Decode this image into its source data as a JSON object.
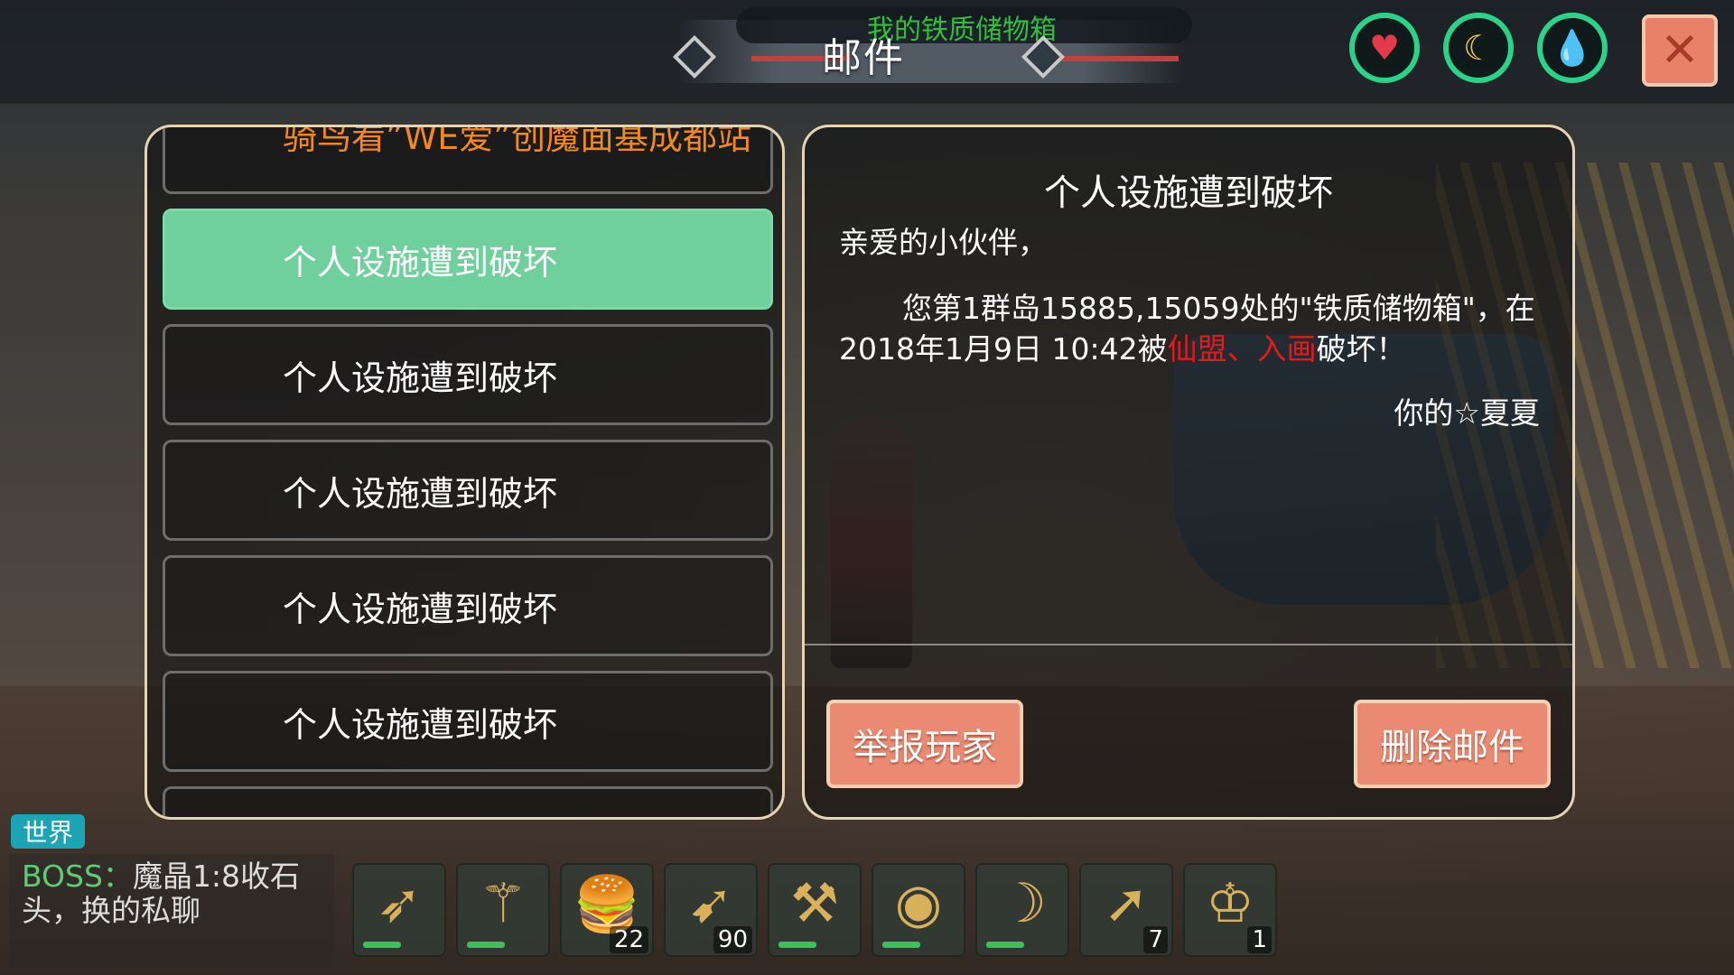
{
  "header": {
    "title": "邮件",
    "subtitle": "我的铁质储物箱"
  },
  "stats": [
    {
      "name": "health",
      "icon": "heart-icon",
      "glyph": "♥",
      "color": "#e23a4a"
    },
    {
      "name": "hunger",
      "icon": "banana-icon",
      "glyph": "☾",
      "color": "#f2d23b"
    },
    {
      "name": "thirst",
      "icon": "water-drop-icon",
      "glyph": "💧",
      "color": "#35c6e6"
    }
  ],
  "close_glyph": "✕",
  "mail_list": {
    "partial_top": "骑鸟看”WE爱”创魔面基成都站",
    "items": [
      {
        "label": "个人设施遭到破坏"
      },
      {
        "label": "个人设施遭到破坏"
      },
      {
        "label": "个人设施遭到破坏"
      },
      {
        "label": "个人设施遭到破坏"
      },
      {
        "label": "个人设施遭到破坏"
      }
    ]
  },
  "mail_detail": {
    "title": "个人设施遭到破坏",
    "greeting": "亲爱的小伙伴，",
    "body_before": "您第1群岛15885,15059处的\"铁质储物箱\"，在2018年1月9日 10:42被",
    "attacker": "仙盟、入画",
    "body_after": "破坏！",
    "signature": "你的☆夏夏",
    "report_button": "举报玩家",
    "delete_button": "删除邮件"
  },
  "chat": {
    "channel": "世界",
    "sender": "BOSS：",
    "message": "魔晶1:8收石头，换的私聊"
  },
  "hotbar": [
    {
      "icon": "bow-icon",
      "glyph": "➶",
      "count": "",
      "durability": true
    },
    {
      "icon": "staff-icon",
      "glyph": "⚚",
      "count": "",
      "durability": true
    },
    {
      "icon": "burger-icon",
      "glyph": "🍔",
      "count": "22",
      "durability": false
    },
    {
      "icon": "spear-icon",
      "glyph": "➹",
      "count": "90",
      "durability": false
    },
    {
      "icon": "pickaxe-icon",
      "glyph": "⚒",
      "count": "",
      "durability": true
    },
    {
      "icon": "waterskin-icon",
      "glyph": "◉",
      "count": "",
      "durability": true
    },
    {
      "icon": "sickle-icon",
      "glyph": "☽",
      "count": "",
      "durability": true
    },
    {
      "icon": "arrow-icon",
      "glyph": "➚",
      "count": "7",
      "durability": false
    },
    {
      "icon": "crown-icon",
      "glyph": "♔",
      "count": "1",
      "durability": false
    }
  ]
}
